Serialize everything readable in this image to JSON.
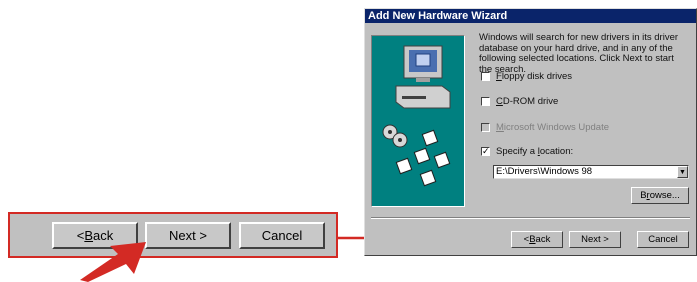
{
  "callout": {
    "back_accel": "B",
    "back_rest": "ack",
    "back_prefix": "< ",
    "next_label": "Next >",
    "cancel_label": "Cancel"
  },
  "dialog": {
    "title": "Add New Hardware Wizard",
    "description": "Windows will search for new drivers in its driver database on your hard drive, and in any of the following selected locations. Click Next to start the search.",
    "options": [
      {
        "accel": "F",
        "rest": "loppy disk drives",
        "checked": false,
        "disabled": false
      },
      {
        "accel": "C",
        "rest": "D-ROM drive",
        "checked": false,
        "disabled": false
      },
      {
        "accel": "M",
        "rest": "icrosoft Windows Update",
        "checked": false,
        "disabled": true
      },
      {
        "prefix": "Specify a ",
        "accel": "l",
        "rest": "ocation:",
        "checked": true,
        "disabled": false
      }
    ],
    "location_value": "E:\\Drivers\\Windows 98",
    "browse_accel": "r",
    "browse_prefix": "B",
    "browse_rest": "owse...",
    "back_prefix": "< ",
    "back_accel": "B",
    "back_rest": "ack",
    "next_label": "Next >",
    "cancel_label": "Cancel",
    "check_mark": "✓"
  },
  "colors": {
    "accent_red": "#d32a24",
    "title_bar": "#0a246a",
    "illustration_teal": "#008080"
  }
}
